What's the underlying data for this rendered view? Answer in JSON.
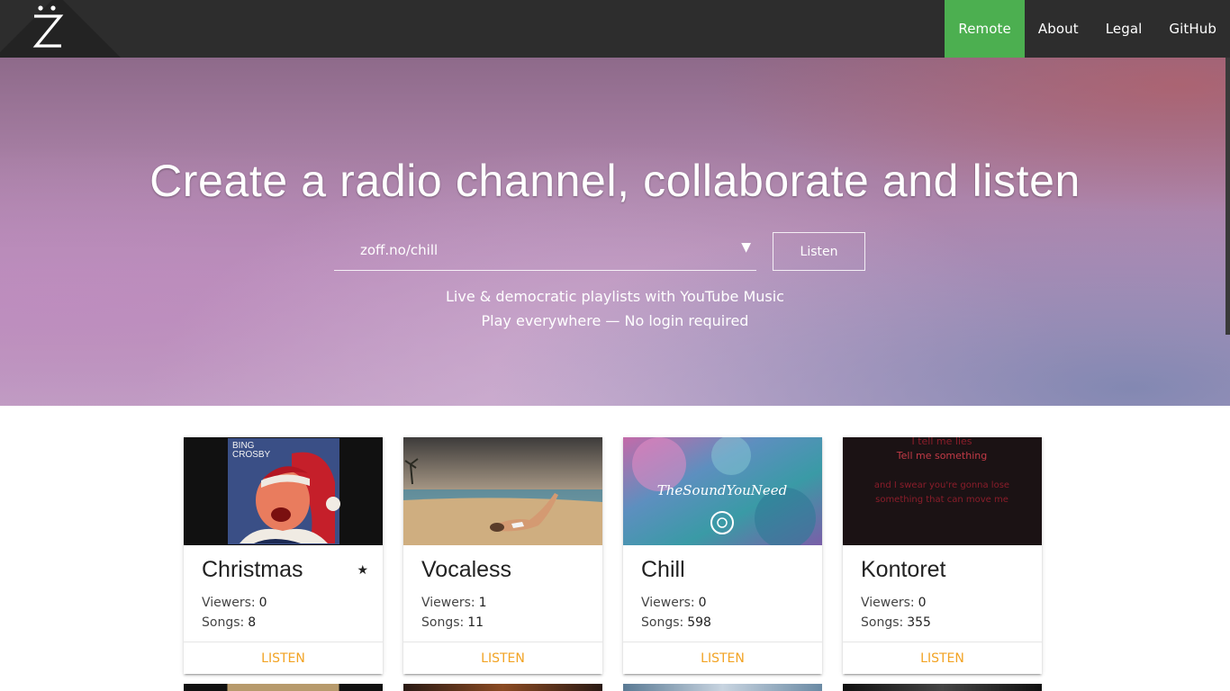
{
  "nav": {
    "logo_alt": "Zoff",
    "links": [
      "Remote",
      "About",
      "Legal",
      "GitHub"
    ],
    "active": "Remote",
    "active_color": "#4caf50"
  },
  "hero": {
    "title": "Create a radio channel, collaborate and listen",
    "channel_input_value": "zoff.no/chill",
    "listen_button": "Listen",
    "tagline_1": "Live & democratic playlists with YouTube Music",
    "tagline_2": "Play everywhere — No login required"
  },
  "channels": [
    {
      "name": "Christmas",
      "starred": true,
      "star_icon": "★",
      "viewers_label": "Viewers:",
      "viewers": "0",
      "songs_label": "Songs:",
      "songs": "8",
      "action": "LISTEN",
      "thumbnail": "christmas-album-art"
    },
    {
      "name": "Vocaless",
      "starred": false,
      "viewers_label": "Viewers:",
      "viewers": "1",
      "songs_label": "Songs:",
      "songs": "11",
      "action": "LISTEN",
      "thumbnail": "beach-photo"
    },
    {
      "name": "Chill",
      "starred": false,
      "viewers_label": "Viewers:",
      "viewers": "0",
      "songs_label": "Songs:",
      "songs": "598",
      "action": "LISTEN",
      "thumbnail": "thesoundyouneed-art"
    },
    {
      "name": "Kontoret",
      "starred": false,
      "viewers_label": "Viewers:",
      "viewers": "0",
      "songs_label": "Songs:",
      "songs": "355",
      "action": "LISTEN",
      "thumbnail": "lyrics-video-art",
      "thumbnail_text": [
        "I tell me lies",
        "Tell me something",
        "and I swear you're gonna lose",
        "something that can move me"
      ]
    }
  ],
  "christmas_thumbnail_text": [
    "BING",
    "CROSBY"
  ],
  "chill_thumbnail_text": "TheSoundYouNeed",
  "action_color": "#f2a323"
}
